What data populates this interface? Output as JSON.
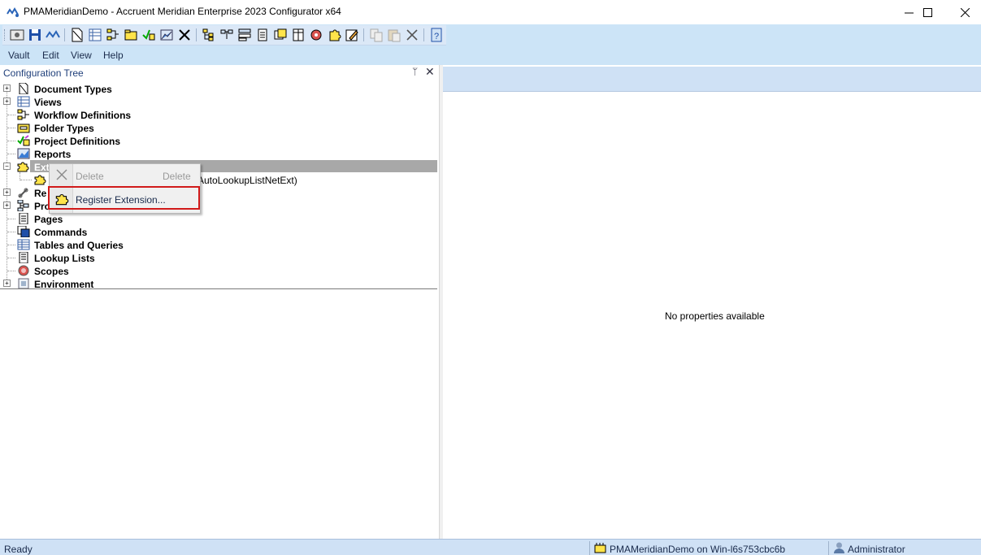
{
  "window": {
    "title": "PMAMeridianDemo - Accruent Meridian Enterprise 2023 Configurator x64",
    "minimize_glyph": "—",
    "maximize_glyph": "☐",
    "close_glyph": "✕"
  },
  "toolbar": {
    "buttons": [
      "vault-properties-icon",
      "save-icon",
      "meridian-icon",
      "document-types-icon",
      "views-icon",
      "workflow-icon",
      "folder-types-icon",
      "project-definitions-icon",
      "reports-icon",
      "extensions-icon",
      "tree-icon",
      "relations-icon",
      "property-pages-icon",
      "pages-icon",
      "commands-icon",
      "tables-icon",
      "lookup-lists-icon",
      "scopes-icon",
      "environment-icon",
      "edit-icon",
      "copy-icon",
      "paste-icon",
      "delete-icon",
      "help-icon"
    ]
  },
  "menu": {
    "items": [
      "Vault",
      "Edit",
      "View",
      "Help"
    ]
  },
  "left_pane": {
    "title": "Configuration Tree",
    "pin_glyph": "ᛘ",
    "close_glyph": "✕"
  },
  "tree": {
    "nodes": [
      {
        "label": "Document Types",
        "icon": "document-types-icon",
        "expandable": true
      },
      {
        "label": "Views",
        "icon": "views-icon",
        "expandable": true
      },
      {
        "label": "Workflow Definitions",
        "icon": "workflow-definitions-icon",
        "expandable": false
      },
      {
        "label": "Folder Types",
        "icon": "folder-types-icon",
        "expandable": false
      },
      {
        "label": "Project Definitions",
        "icon": "project-definitions-icon",
        "expandable": false
      },
      {
        "label": "Reports",
        "icon": "reports-icon",
        "expandable": false
      },
      {
        "label": "Ext",
        "icon": "extensions-icon",
        "expandable": true,
        "expanded": true,
        "selected": true
      },
      {
        "label": "AutoLookupListNetExt)",
        "icon": "extension-item-icon",
        "child": true
      },
      {
        "label": "Re",
        "icon": "relations-icon",
        "expandable": true
      },
      {
        "label": "Pro",
        "icon": "property-pages-icon",
        "expandable": true
      },
      {
        "label": "Pages",
        "icon": "pages-icon",
        "expandable": false
      },
      {
        "label": "Commands",
        "icon": "commands-icon",
        "expandable": false
      },
      {
        "label": "Tables and Queries",
        "icon": "tables-and-queries-icon",
        "expandable": false
      },
      {
        "label": "Lookup Lists",
        "icon": "lookup-lists-icon",
        "expandable": false
      },
      {
        "label": "Scopes",
        "icon": "scopes-icon",
        "expandable": false
      },
      {
        "label": "Environment",
        "icon": "environment-icon",
        "expandable": true
      }
    ]
  },
  "context_menu": {
    "delete_label": "Delete",
    "delete_shortcut": "Delete",
    "register_label": "Register Extension..."
  },
  "right_pane": {
    "empty_text": "No properties available"
  },
  "statusbar": {
    "status": "Ready",
    "vault": "PMAMeridianDemo on Win-l6s753cbc6b",
    "user": "Administrator"
  },
  "colors": {
    "toolbar_band": "#cce4f7",
    "selection": "#a8a8a8",
    "highlight_border": "#d11a1a",
    "status_bar": "#cfe1f5"
  }
}
